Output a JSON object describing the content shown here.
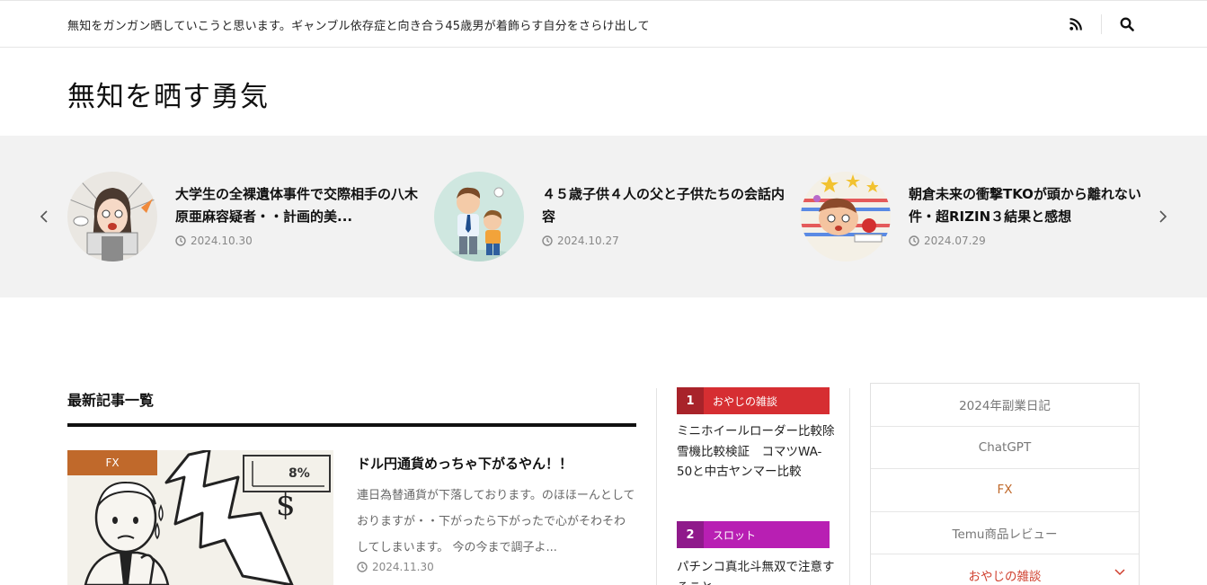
{
  "header": {
    "tagline": "無知をガンガン晒していこうと思います。ギャンブル依存症と向き合う45歳男が着飾らす自分をさらけ出して",
    "rss_icon": "rss-icon",
    "search_icon": "search-icon"
  },
  "site": {
    "title": "無知を晒す勇気"
  },
  "slider": {
    "prev_icon": "chevron-left-icon",
    "next_icon": "chevron-right-icon",
    "slides": [
      {
        "title": "大学生の全裸遺体事件で交際相手の八木原亜麻容疑者・・計画的美...",
        "date": "2024.10.30"
      },
      {
        "title": "４５歳子供４人の父と子供たちの会話内容",
        "date": "2024.10.27"
      },
      {
        "title": "朝倉未来の衝撃TKOが頭から離れない件・超RIZIN３結果と感想",
        "date": "2024.07.29"
      }
    ]
  },
  "main": {
    "section_title": "最新記事一覧",
    "posts": [
      {
        "category": "FX",
        "title": "ドル円通貨めっちゃ下がるやん！！",
        "excerpt": "連日為替通貨が下落しております。のほほーんとしておりますが・・下がったら下がったで心がそわそわしてしまいます。 今の今まで調子よ...",
        "date": "2024.11.30",
        "thumb_text": {
          "percent": "8%",
          "dollar": "$"
        }
      }
    ]
  },
  "ranking": [
    {
      "num": "1",
      "category": "おやじの雑談",
      "color": "#d62e32",
      "num_color": "#a8232a",
      "title": "ミニホイールローダー比較除雪機比較検証　コマツWA-50と中古ヤンマー比較"
    },
    {
      "num": "2",
      "category": "スロット",
      "color": "#b81fb3",
      "num_color": "#8f1a8b",
      "title": "パチンコ真北斗無双で注意すること"
    }
  ],
  "categories": {
    "items": [
      {
        "label": "2024年副業日記",
        "state": "normal"
      },
      {
        "label": "ChatGPT",
        "state": "normal"
      },
      {
        "label": "FX",
        "state": "active"
      },
      {
        "label": "Temu商品レビュー",
        "state": "normal"
      },
      {
        "label": "おやじの雑談",
        "state": "expand"
      }
    ],
    "expand_icon": "chevron-down-icon"
  },
  "colors": {
    "accent": "#c0692b",
    "rank1": "#d62e32",
    "rank2": "#b81fb3",
    "slider_bg": "#f2f2f2"
  }
}
